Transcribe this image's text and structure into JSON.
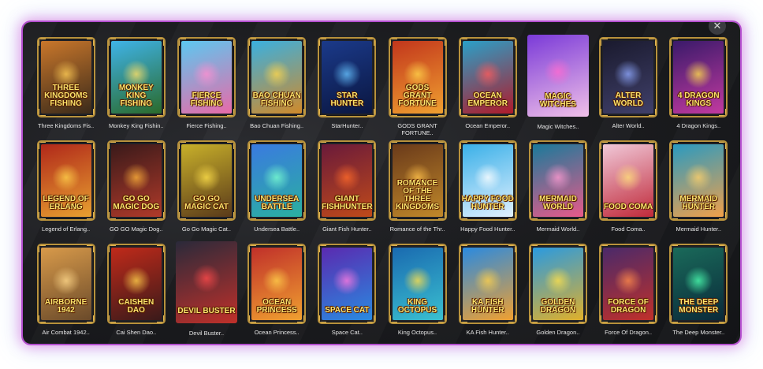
{
  "window": {
    "close_glyph": "✕",
    "close_icon": "close-icon"
  },
  "games": [
    {
      "label": "Three Kingdoms Fis..",
      "logo": "Three kingdoms Fishing",
      "bg": [
        "#c9772b",
        "#3a2a1a"
      ],
      "glow": "#ffcc55"
    },
    {
      "label": "Monkey King Fishin..",
      "logo": "Monkey King Fishing",
      "bg": [
        "#3fb3e8",
        "#2a6a2a"
      ],
      "glow": "#ffe066"
    },
    {
      "label": "Fierce Fishing..",
      "logo": "Fierce Fishing",
      "bg": [
        "#5cc8f0",
        "#e86aa8"
      ],
      "glow": "#ff8fd0"
    },
    {
      "label": "Bao Chuan Fishing..",
      "logo": "Bao Chuan Fishing",
      "bg": [
        "#3ab0e0",
        "#d08a2a"
      ],
      "glow": "#ffd54a"
    },
    {
      "label": "StarHunter..",
      "logo": "Star Hunter",
      "bg": [
        "#1b3a8a",
        "#0a1640"
      ],
      "glow": "#66c2ff"
    },
    {
      "label": "GODS GRANT FORTUNE..",
      "logo": "Gods Grant Fortune",
      "bg": [
        "#c2361c",
        "#f0a030"
      ],
      "glow": "#ffd34a"
    },
    {
      "label": "Ocean Emperor..",
      "logo": "Ocean Emperor",
      "bg": [
        "#2aa0c8",
        "#b01a2a"
      ],
      "glow": "#ff5a5a"
    },
    {
      "label": "Magic Witches..",
      "logo": "Magic Witches",
      "bg": [
        "#7a3ad8",
        "#f0c0e8"
      ],
      "glow": "#ff6ad0"
    },
    {
      "label": "Alter World..",
      "logo": "Alter World",
      "bg": [
        "#1a1a2e",
        "#40406a"
      ],
      "glow": "#8fa8ff"
    },
    {
      "label": "4 Dragon Kings..",
      "logo": "4 Dragon Kings",
      "bg": [
        "#3a1a6a",
        "#c23aa0"
      ],
      "glow": "#ffdc4a"
    },
    {
      "label": "Legend of Erlang..",
      "logo": "Legend of Erlang",
      "bg": [
        "#b0281a",
        "#e8a030"
      ],
      "glow": "#ffd24a"
    },
    {
      "label": "GO GO Magic Dog..",
      "logo": "Go Go Magic Dog",
      "bg": [
        "#3a1a1a",
        "#b03a2a"
      ],
      "glow": "#ffb23a"
    },
    {
      "label": "Go Go Magic Cat..",
      "logo": "Go Go Magic Cat",
      "bg": [
        "#c8b02a",
        "#5a3a1a"
      ],
      "glow": "#ffe04a"
    },
    {
      "label": "Undersea Battle..",
      "logo": "Undersea Battle",
      "bg": [
        "#3a7ae0",
        "#2ab0a0"
      ],
      "glow": "#7affd0"
    },
    {
      "label": "Giant Fish Hunter..",
      "logo": "Giant Fishhunter",
      "bg": [
        "#6a1a3a",
        "#c04a1a"
      ],
      "glow": "#ff6a2a"
    },
    {
      "label": "Romance of the Thr..",
      "logo": "Romance of the Three Kingdoms",
      "bg": [
        "#6a3a1a",
        "#c0882a"
      ],
      "glow": "#ffc04a"
    },
    {
      "label": "Happy Food Hunter..",
      "logo": "Happy Food Hunter",
      "bg": [
        "#3ab0e8",
        "#e0f0ff"
      ],
      "glow": "#ffffff"
    },
    {
      "label": "Mermaid World..",
      "logo": "Mermaid World",
      "bg": [
        "#1a7a9a",
        "#e85a8a"
      ],
      "glow": "#ff9ad0"
    },
    {
      "label": "Food Coma..",
      "logo": "Food Coma",
      "bg": [
        "#f0c8d8",
        "#c02a3a"
      ],
      "glow": "#ffe07a"
    },
    {
      "label": "Mermaid Hunter..",
      "logo": "Mermaid Hunter",
      "bg": [
        "#2a9ac0",
        "#f0a04a"
      ],
      "glow": "#ffd06a"
    },
    {
      "label": "Air Combat 1942..",
      "logo": "Airborne 1942",
      "bg": [
        "#d89a4a",
        "#6a4a2a"
      ],
      "glow": "#ffd88a"
    },
    {
      "label": "Cai Shen Dao..",
      "logo": "Caishen Dao",
      "bg": [
        "#c02a1a",
        "#3a1a1a"
      ],
      "glow": "#ffd04a"
    },
    {
      "label": "Devil Buster..",
      "logo": "Devil Buster",
      "bg": [
        "#2a2a3a",
        "#c0302a"
      ],
      "glow": "#ff4a4a"
    },
    {
      "label": "Ocean Princess..",
      "logo": "Ocean Princess",
      "bg": [
        "#c0302a",
        "#f0a030"
      ],
      "glow": "#ffd04a"
    },
    {
      "label": "Space Cat..",
      "logo": "Space Cat",
      "bg": [
        "#5a2ab0",
        "#2a8ae0"
      ],
      "glow": "#ff7ae0"
    },
    {
      "label": "King Octopus..",
      "logo": "King Octopus",
      "bg": [
        "#1a6ab0",
        "#3ac0d0"
      ],
      "glow": "#ffe04a"
    },
    {
      "label": "KA Fish Hunter..",
      "logo": "KA Fish Hunter",
      "bg": [
        "#2a8ae0",
        "#f0a030"
      ],
      "glow": "#ffd04a"
    },
    {
      "label": "Golden Dragon..",
      "logo": "Golden Dragon",
      "bg": [
        "#2a9ae0",
        "#e0b02a"
      ],
      "glow": "#ffe04a"
    },
    {
      "label": "Force Of Dragon..",
      "logo": "Force of Dragon",
      "bg": [
        "#4a2a6a",
        "#c0302a"
      ],
      "glow": "#ff8a4a"
    },
    {
      "label": "The Deep Monster..",
      "logo": "The Deep Monster",
      "bg": [
        "#1a6a5a",
        "#0a2a3a"
      ],
      "glow": "#4affb0"
    }
  ]
}
